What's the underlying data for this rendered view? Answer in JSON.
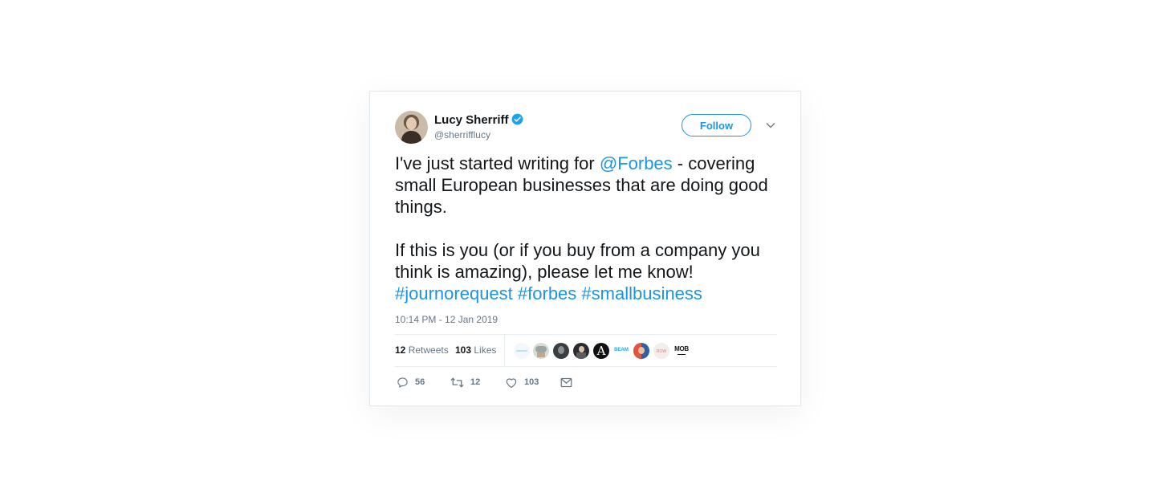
{
  "tweet": {
    "author": {
      "name": "Lucy Sherriff",
      "handle": "@sherrifflucy",
      "verified": true,
      "avatar_icon": "profile-photo"
    },
    "follow_label": "Follow",
    "text": {
      "p1_before": "I've just started writing for ",
      "p1_mention": "@Forbes",
      "p1_after": " - covering small European businesses that are doing good things.",
      "p2": "If this is you (or if you buy from a company you think is amazing), please let me know!",
      "hashtags": [
        "#journorequest",
        "#forbes",
        "#smallbusiness"
      ]
    },
    "timestamp": "10:14 PM - 12 Jan 2019",
    "stats": {
      "retweets_count": "12",
      "retweets_label": "Retweets",
      "likes_count": "103",
      "likes_label": "Likes"
    },
    "facepile": [
      {
        "icon": "faint-logo-avatar"
      },
      {
        "icon": "photo-avatar-1"
      },
      {
        "icon": "dark-photo-avatar"
      },
      {
        "icon": "dark-photo-avatar-2"
      },
      {
        "icon": "letter-a-logo-avatar",
        "text": "A"
      },
      {
        "icon": "beam-logo-avatar",
        "text": "BEAM"
      },
      {
        "icon": "photo-avatar-2"
      },
      {
        "icon": "pink-logo-avatar",
        "text": "ROW"
      },
      {
        "icon": "mob-logo-avatar",
        "text": "MOB"
      }
    ],
    "actions": {
      "replies": "56",
      "retweets": "12",
      "likes": "103"
    }
  },
  "colors": {
    "accent": "#1b95e0",
    "text": "#14171a",
    "muted": "#657786",
    "border": "#e1e8ed"
  }
}
